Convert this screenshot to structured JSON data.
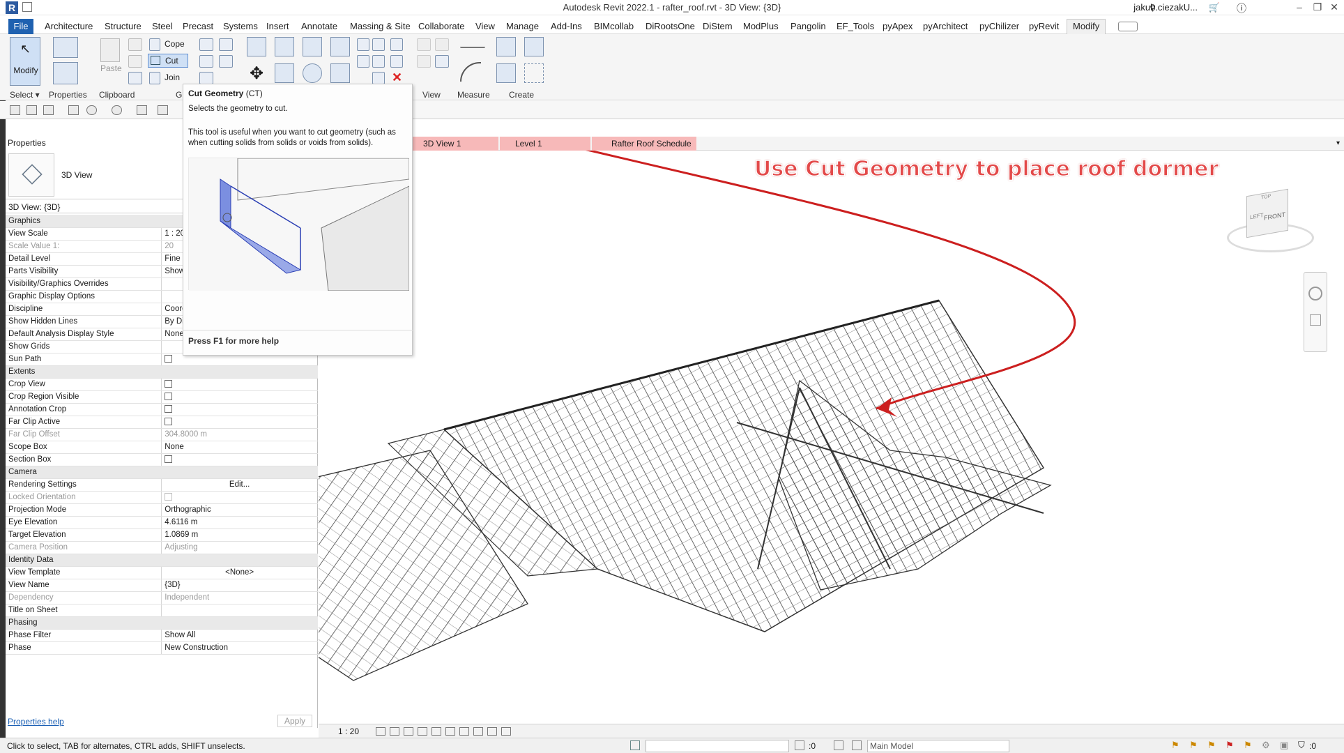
{
  "window": {
    "title": "Autodesk Revit 2022.1 - rafter_roof.rvt - 3D View: {3D}",
    "user": "jakub.ciezakU...",
    "controls": [
      "–",
      "❐",
      "✕"
    ]
  },
  "menu": {
    "file": "File",
    "tabs": [
      "Architecture",
      "Structure",
      "Steel",
      "Precast",
      "Systems",
      "Insert",
      "Annotate",
      "Massing & Site",
      "Collaborate",
      "View",
      "Manage",
      "Add-Ins",
      "BIMcollab",
      "DiRootsOne",
      "DiStem",
      "ModPlus",
      "Pangolin",
      "EF_Tools",
      "pyApex",
      "pyArchitect",
      "pyChilizer",
      "pyRevit"
    ],
    "active": "Modify"
  },
  "ribbon": {
    "modify": "Modify",
    "select": "Select ▾",
    "properties": "Properties",
    "clipboard": "Clipboard",
    "paste": "Paste",
    "cope": "Cope",
    "cut": "Cut",
    "join": "Join",
    "geometry_short": "G",
    "view": "View",
    "measure": "Measure",
    "create": "Create"
  },
  "tooltip": {
    "title": "Cut Geometry",
    "shortcut": "(CT)",
    "subtitle": "Selects the geometry to cut.",
    "description": "This tool is useful when you want to cut geometry (such as when cutting solids from solids or voids from solids).",
    "help": "Press F1 for more help"
  },
  "view_tabs": [
    "3D View 1",
    "Level 1",
    "Rafter Roof Schedule"
  ],
  "properties": {
    "header": "Properties",
    "type_name": "3D View",
    "view_label": "3D View: {3D}",
    "rows": [
      {
        "group": "Graphics"
      },
      {
        "name": "View Scale",
        "value": "1 : 20"
      },
      {
        "name": "Scale Value    1:",
        "value": "20",
        "disabled": true
      },
      {
        "name": "Detail Level",
        "value": "Fine"
      },
      {
        "name": "Parts Visibility",
        "value": "Show"
      },
      {
        "name": "Visibility/Graphics Overrides",
        "value": ""
      },
      {
        "name": "Graphic Display Options",
        "value": ""
      },
      {
        "name": "Discipline",
        "value": "Coord"
      },
      {
        "name": "Show Hidden Lines",
        "value": "By Dis"
      },
      {
        "name": "Default Analysis Display Style",
        "value": "None"
      },
      {
        "name": "Show Grids",
        "value": ""
      },
      {
        "name": "Sun Path",
        "check": true
      },
      {
        "group": "Extents"
      },
      {
        "name": "Crop View",
        "check": true
      },
      {
        "name": "Crop Region Visible",
        "check": true
      },
      {
        "name": "Annotation Crop",
        "check": true
      },
      {
        "name": "Far Clip Active",
        "check": true
      },
      {
        "name": "Far Clip Offset",
        "value": "304.8000 m",
        "disabled": true
      },
      {
        "name": "Scope Box",
        "value": "None"
      },
      {
        "name": "Section Box",
        "check": true
      },
      {
        "group": "Camera"
      },
      {
        "name": "Rendering Settings",
        "value": "Edit...",
        "button": true
      },
      {
        "name": "Locked Orientation",
        "check": true,
        "disabled": true
      },
      {
        "name": "Projection Mode",
        "value": "Orthographic"
      },
      {
        "name": "Eye Elevation",
        "value": "4.6116 m"
      },
      {
        "name": "Target Elevation",
        "value": "1.0869 m"
      },
      {
        "name": "Camera Position",
        "value": "Adjusting",
        "disabled": true
      },
      {
        "group": "Identity Data"
      },
      {
        "name": "View Template",
        "value": "<None>",
        "button": true
      },
      {
        "name": "View Name",
        "value": "{3D}"
      },
      {
        "name": "Dependency",
        "value": "Independent",
        "disabled": true
      },
      {
        "name": "Title on Sheet",
        "value": ""
      },
      {
        "group": "Phasing"
      },
      {
        "name": "Phase Filter",
        "value": "Show All"
      },
      {
        "name": "Phase",
        "value": "New Construction"
      }
    ],
    "help_link": "Properties help",
    "apply": "Apply"
  },
  "canvas": {
    "annotation": "Use Cut Geometry to place roof dormer",
    "viewcube_labels": [
      "TOP",
      "LEFT",
      "FRONT"
    ]
  },
  "view_control": {
    "scale": "1 : 20"
  },
  "status": {
    "message": "Click to select, TAB for alternates, CTRL adds, SHIFT unselects.",
    "workset_count": ":0",
    "model": "Main Model",
    "filter_count": ":0"
  },
  "colors": {
    "file_tab": "#1f61b0",
    "annotation": "#e34a4a",
    "view_tab_highlight": "#f7b9b9"
  }
}
